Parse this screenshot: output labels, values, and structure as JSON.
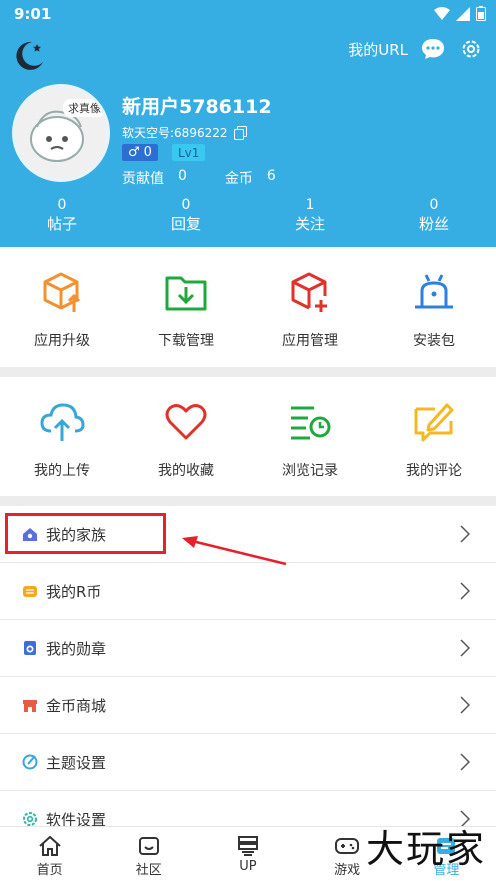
{
  "status": {
    "time": "9:01"
  },
  "header": {
    "url_link": "我的URL",
    "username": "新用户5786112",
    "soft_id": "软天空号:6896222",
    "avatar_tag": "求真像",
    "gender_count": "0",
    "level": "Lv1",
    "contribution_label": "贡献值",
    "contribution_value": "0",
    "coin_label": "金币",
    "coin_value": "6",
    "stats": [
      {
        "num": "0",
        "label": "帖子"
      },
      {
        "num": "0",
        "label": "回复"
      },
      {
        "num": "1",
        "label": "关注"
      },
      {
        "num": "0",
        "label": "粉丝"
      }
    ]
  },
  "grid1": [
    {
      "label": "应用升级",
      "icon": "box-upgrade-icon",
      "color": "#f39130"
    },
    {
      "label": "下载管理",
      "icon": "folder-download-icon",
      "color": "#1fa83c"
    },
    {
      "label": "应用管理",
      "icon": "box-add-icon",
      "color": "#e0312b"
    },
    {
      "label": "安装包",
      "icon": "android-icon",
      "color": "#2e7fe0"
    }
  ],
  "grid2": [
    {
      "label": "我的上传",
      "icon": "cloud-upload-icon",
      "color": "#3aa6d8"
    },
    {
      "label": "我的收藏",
      "icon": "heart-icon",
      "color": "#e0312b"
    },
    {
      "label": "浏览记录",
      "icon": "history-icon",
      "color": "#1fa83c"
    },
    {
      "label": "我的评论",
      "icon": "comment-edit-icon",
      "color": "#f5b820"
    }
  ],
  "menu": [
    {
      "label": "我的家族",
      "icon": "family-icon",
      "color": "#5b6ee0"
    },
    {
      "label": "我的R币",
      "icon": "coin-stack-icon",
      "color": "#f5a623"
    },
    {
      "label": "我的勋章",
      "icon": "medal-icon",
      "color": "#3f6fd6"
    },
    {
      "label": "金币商城",
      "icon": "store-icon",
      "color": "#e85a45"
    },
    {
      "label": "主题设置",
      "icon": "palette-icon",
      "color": "#3aa6d8"
    },
    {
      "label": "软件设置",
      "icon": "gear-icon",
      "color": "#2ab8a0"
    }
  ],
  "tabs": [
    {
      "label": "首页",
      "icon": "home-icon"
    },
    {
      "label": "社区",
      "icon": "community-icon"
    },
    {
      "label": "UP",
      "icon": "upload-stack-icon"
    },
    {
      "label": "游戏",
      "icon": "gamepad-icon"
    },
    {
      "label": "管理",
      "icon": "manage-icon",
      "active": true
    }
  ],
  "watermark": "大玩家",
  "colors": {
    "header_bg": "#37aee3",
    "highlight": "#e5212c"
  }
}
